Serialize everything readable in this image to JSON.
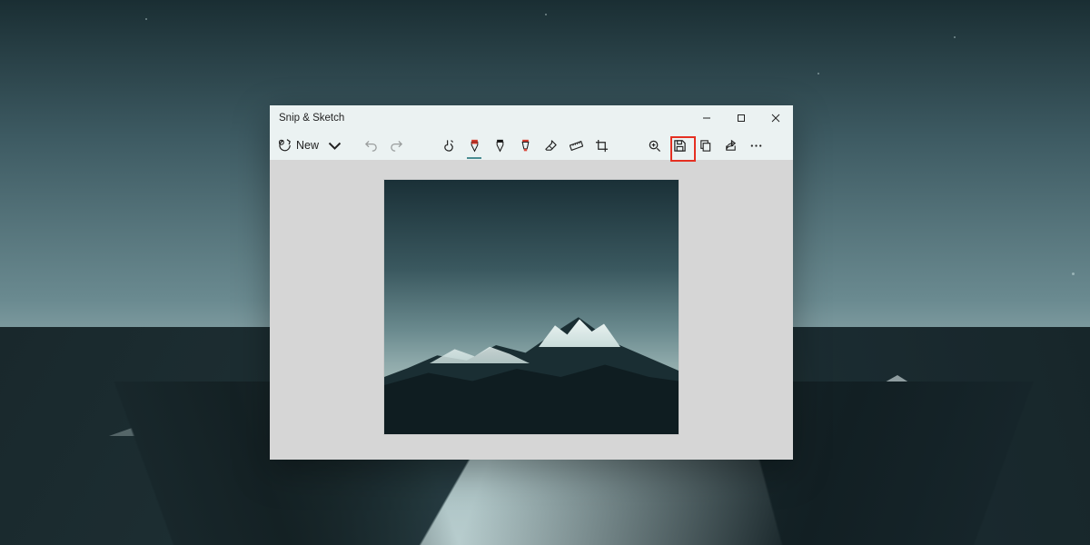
{
  "app": {
    "title": "Snip & Sketch"
  },
  "toolbar": {
    "new_label": "New",
    "icons": {
      "new": "new-snip-icon",
      "new_dropdown": "chevron-down-icon",
      "undo": "undo-icon",
      "redo": "redo-icon",
      "touch_writing": "touch-writing-icon",
      "ballpoint": "ballpoint-pen-icon",
      "pencil": "pencil-icon",
      "highlighter": "highlighter-icon",
      "eraser": "eraser-icon",
      "ruler": "ruler-icon",
      "crop": "crop-icon",
      "zoom": "zoom-icon",
      "save": "save-icon",
      "copy": "copy-icon",
      "share": "share-icon",
      "more": "more-icon"
    },
    "active_tool": "ballpoint",
    "pen_colors": {
      "ballpoint": "#d93a2b",
      "pencil": "#111111",
      "highlighter": "#d93a2b"
    }
  },
  "window_controls": {
    "minimize": "minimize-icon",
    "maximize": "maximize-icon",
    "close": "close-icon"
  },
  "annotation": {
    "highlighted_button": "save"
  },
  "colors": {
    "window_chrome": "#ebf2f2",
    "canvas_bg": "#d6d6d6",
    "accent_underline": "#4a8d92",
    "highlight_box": "#e53022"
  }
}
